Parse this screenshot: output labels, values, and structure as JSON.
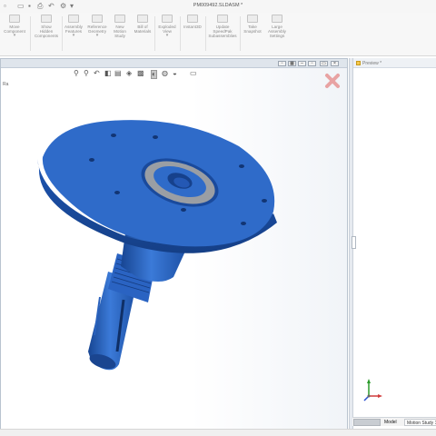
{
  "window": {
    "title": "PM009492.SLDASM *"
  },
  "quick_access": {
    "icons": [
      "new-document-icon",
      "open-icon",
      "save-icon",
      "print-icon",
      "undo-icon",
      "select-icon",
      "rebuild-icon",
      "options-icon"
    ]
  },
  "ribbon": {
    "buttons": [
      {
        "id": "move-component",
        "label": "Move\nComponent",
        "dropdown": true,
        "icon": "move-icon"
      },
      {
        "id": "show-hidden",
        "label": "Show\nHidden\nComponents",
        "dropdown": false,
        "icon": "show-hidden-icon"
      },
      {
        "id": "assembly-features",
        "label": "Assembly\nFeatures",
        "dropdown": true,
        "icon": "assembly-features-icon"
      },
      {
        "id": "reference-geometry",
        "label": "Reference\nGeometry",
        "dropdown": true,
        "icon": "reference-geometry-icon"
      },
      {
        "id": "new-motion-study",
        "label": "New\nMotion\nStudy",
        "dropdown": false,
        "icon": "motion-study-icon"
      },
      {
        "id": "bill-of-materials",
        "label": "Bill of\nMaterials",
        "dropdown": false,
        "icon": "bom-icon"
      },
      {
        "id": "exploded-view",
        "label": "Exploded\nView",
        "dropdown": true,
        "icon": "exploded-view-icon"
      },
      {
        "id": "instant3d",
        "label": "Instant3D",
        "dropdown": false,
        "icon": "instant3d-icon"
      },
      {
        "id": "speedpak",
        "label": "Update\nSpeedPak\nSubassemblies",
        "dropdown": false,
        "icon": "speedpak-icon"
      },
      {
        "id": "snapshot",
        "label": "Take\nSnapshot",
        "dropdown": false,
        "icon": "camera-icon"
      },
      {
        "id": "large-assembly",
        "label": "Large\nAssembly\nSettings",
        "dropdown": false,
        "icon": "large-assembly-icon"
      }
    ]
  },
  "graphics": {
    "tree_fragment": "Ra",
    "view_toolbar_icons": [
      "zoom-to-fit-icon",
      "zoom-area-icon",
      "previous-view-icon",
      "section-view-icon",
      "dynamic-annotation-icon",
      "view-orientation-icon",
      "display-style-icon",
      "hide-show-icon",
      "edit-appearance-icon",
      "apply-scene-icon",
      "view-settings-icon"
    ],
    "window_buttons": [
      "restore-icon",
      "tile-icon",
      "minimize-icon",
      "maximize-icon",
      "close-icon"
    ],
    "model_color": "#2f6bc9",
    "model_dark": "#1a4a9c",
    "model_light": "#5f95e6",
    "confirmation_corner": "close-icon"
  },
  "right_panel": {
    "title": "Preview *"
  },
  "bottom_tabs": {
    "model": "Model",
    "motion_study": "Motion Study 1"
  },
  "colors": {
    "accent": "#2f6bc9",
    "close_red": "#e8a3a3"
  }
}
